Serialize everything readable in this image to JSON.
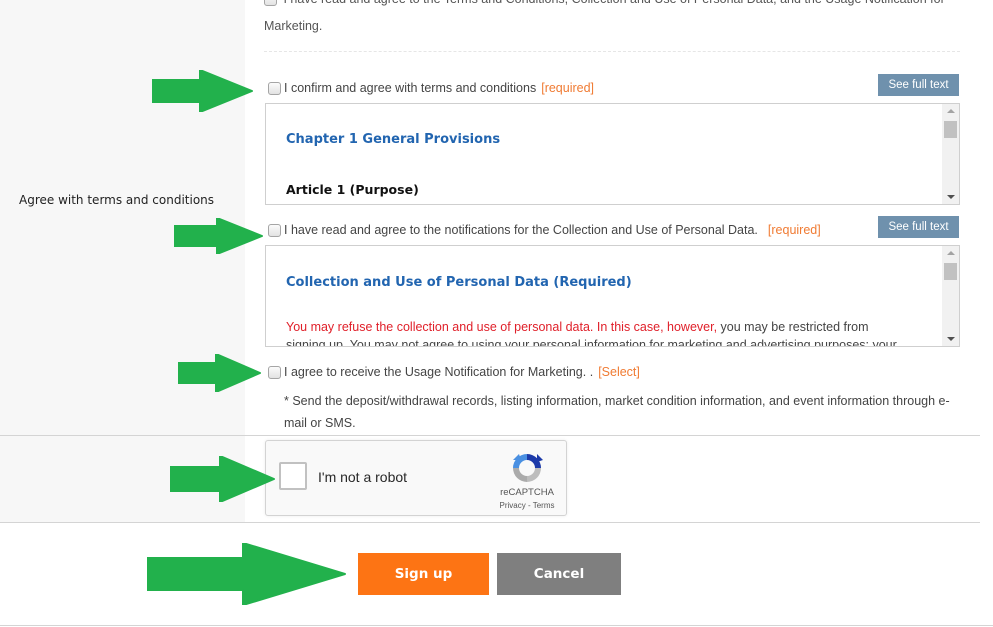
{
  "section_label": "Agree with terms and conditions",
  "all_agree": {
    "text_line1": "I have read and agree to the Terms and Conditions, Collection and Use of Personal Data, and the Usage Notification for",
    "text_line2": "Marketing."
  },
  "terms": {
    "checkbox_label": "I confirm and agree with terms and conditions",
    "tag": "[required]",
    "see_full_text": "See full text",
    "checked": false,
    "content": {
      "heading": "Chapter 1 General Provisions",
      "article": "Article 1 (Purpose)"
    }
  },
  "personal_data": {
    "checkbox_label": "I have read and agree to the notifications for the Collection and Use of Personal Data.",
    "tag": "[required]",
    "see_full_text": "See full text",
    "checked": false,
    "content": {
      "heading": "Collection and Use of Personal Data (Required)",
      "red_text": "You may refuse the collection and use of personal data. In this case, however,",
      "text_cont": " you may be restricted from signing up. You may not agree to using your personal information for marketing and advertising purposes; your access to"
    }
  },
  "marketing": {
    "checkbox_label": "I agree to receive the Usage Notification for Marketing. .",
    "tag": "[Select]",
    "checked": false,
    "note": "* Send the deposit/withdrawal records, listing information, market condition information, and event information through e-mail or SMS."
  },
  "recaptcha": {
    "label": "I'm not a robot",
    "brand": "reCAPTCHA",
    "links": "Privacy - Terms",
    "checked": false
  },
  "buttons": {
    "signup": "Sign up",
    "cancel": "Cancel"
  },
  "colors": {
    "accent_orange": "#fd7414",
    "cancel_gray": "#7f7f7f",
    "see_full_text_bg": "#6f91ad",
    "heading_blue": "#2265b0",
    "required_tag": "#f07b33",
    "arrow_green": "#22b14c"
  },
  "annotations": {
    "arrow_count": 5,
    "arrow_icon": "green-arrow-right"
  }
}
